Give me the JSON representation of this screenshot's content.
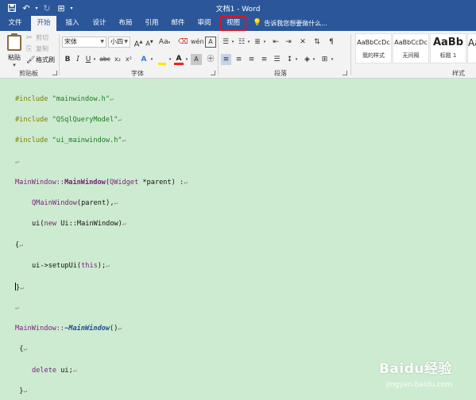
{
  "window": {
    "title": "文档1 - Word"
  },
  "qat": {
    "save_glyph": "💾",
    "undo_glyph": "↶",
    "redo_glyph": "↻",
    "custom_glyph": "⊞"
  },
  "tabs": [
    {
      "label": "文件"
    },
    {
      "label": "开始"
    },
    {
      "label": "插入"
    },
    {
      "label": "设计"
    },
    {
      "label": "布局"
    },
    {
      "label": "引用"
    },
    {
      "label": "邮件"
    },
    {
      "label": "审阅"
    },
    {
      "label": "视图"
    }
  ],
  "tellme": {
    "placeholder": "告诉我您想要做什么..."
  },
  "clipboard": {
    "paste": "粘贴",
    "cut": "剪切",
    "copy": "复制",
    "format_painter": "格式刷",
    "group": "剪贴板"
  },
  "font": {
    "name": "宋体",
    "size": "小四",
    "group": "字体",
    "grow": "A",
    "shrink": "A",
    "case": "Aa",
    "bold": "B",
    "italic": "I",
    "underline": "U",
    "strike": "abc",
    "subscript": "x₂",
    "superscript": "x²"
  },
  "paragraph": {
    "group": "段落"
  },
  "styles": {
    "group": "样式",
    "items": [
      {
        "sample": "AaBbCcDc",
        "name": "我的样式"
      },
      {
        "sample": "AaBbCcDc",
        "name": "无间隔"
      },
      {
        "sample": "AaBb",
        "name": "标题 1"
      },
      {
        "sample": "Aa",
        "name": ""
      }
    ]
  },
  "code": {
    "l1_directive": "#include",
    "l1_file": "\"mainwindow.h\"",
    "l2_directive": "#include",
    "l2_file": "\"QSqlQueryModel\"",
    "l3_directive": "#include",
    "l3_file": "\"ui_mainwindow.h\"",
    "l5_class": "MainWindow::",
    "l5_ctor": "MainWindow",
    "l5_open": "(",
    "l5_type": "QWidget",
    "l5_param": " *parent",
    "l5_close": ") :",
    "l6_base": "QMainWindow",
    "l6_args": "(parent),",
    "l7_ui": "ui(",
    "l7_new": "new",
    "l7_rest": " Ui::MainWindow)",
    "l8_brace": "{",
    "l9_call": "ui->setupUi(",
    "l9_this": "this",
    "l9_end": ");",
    "l10_brace": "}",
    "l12_class": "MainWindow::",
    "l12_dtor": "~MainWindow",
    "l12_parens": "()",
    "l13_brace": "{",
    "l14_delete": "delete",
    "l14_rest": " ui;",
    "l15_brace": "}"
  },
  "para_mark": "↵",
  "watermark": {
    "brand": "Baidu经验",
    "url": "jingyan.baidu.com"
  },
  "colors": {
    "titlebar": "#2b579a",
    "document": "#cdebd1",
    "highlight_box": "#e0141c"
  }
}
